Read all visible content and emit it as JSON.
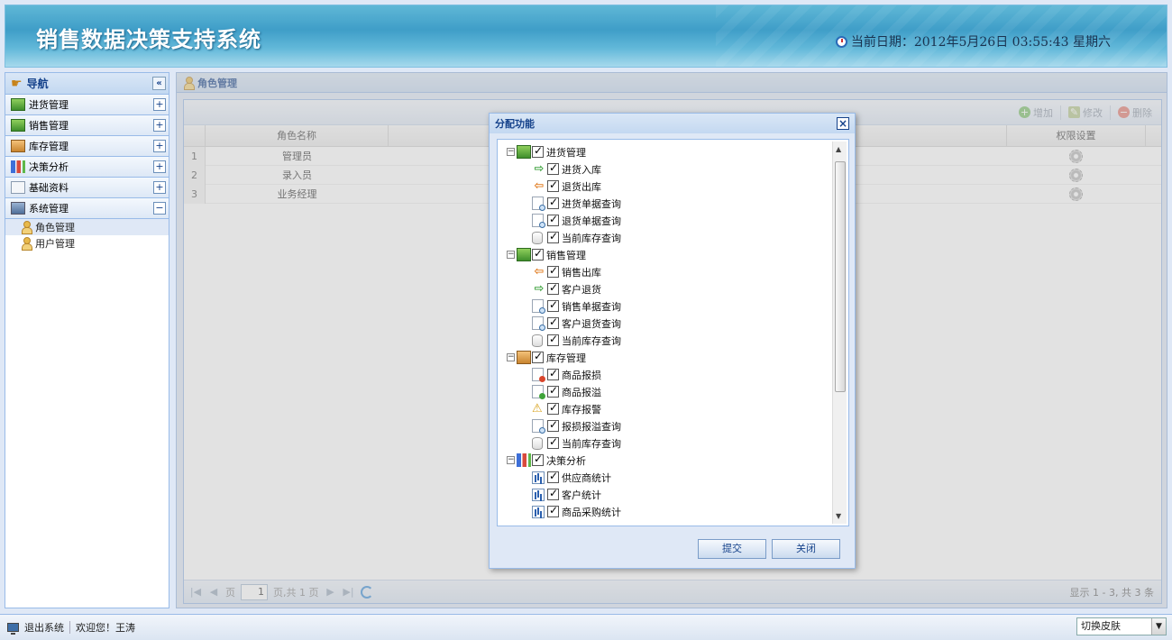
{
  "header": {
    "title": "销售数据决策支持系统",
    "date_label": "当前日期：2012年5月26日  03:55:43 星期六"
  },
  "sidebar": {
    "title": "导航",
    "groups": [
      {
        "label": "进货管理",
        "toggle": "+"
      },
      {
        "label": "销售管理",
        "toggle": "+"
      },
      {
        "label": "库存管理",
        "toggle": "+"
      },
      {
        "label": "决策分析",
        "toggle": "+"
      },
      {
        "label": "基础资料",
        "toggle": "+"
      },
      {
        "label": "系统管理",
        "toggle": "−"
      }
    ],
    "sub_items": [
      {
        "label": "角色管理"
      },
      {
        "label": "用户管理"
      }
    ]
  },
  "main": {
    "title": "角色管理",
    "toolbar": {
      "add": "增加",
      "edit": "修改",
      "delete": "删除"
    },
    "columns": {
      "name": "角色名称",
      "perm": "权限设置"
    },
    "rows": [
      {
        "num": "1",
        "name": "管理员"
      },
      {
        "num": "2",
        "name": "录入员"
      },
      {
        "num": "3",
        "name": "业务经理"
      }
    ],
    "pager": {
      "page_prefix": "页",
      "page_value": "1",
      "page_suffix": "页,共 1 页",
      "info": "显示 1 - 3, 共 3 条"
    }
  },
  "dialog": {
    "title": "分配功能",
    "tree": [
      {
        "label": "进货管理",
        "children": [
          "进货入库",
          "退货出库",
          "进货单据查询",
          "退货单据查询",
          "当前库存查询"
        ]
      },
      {
        "label": "销售管理",
        "children": [
          "销售出库",
          "客户退货",
          "销售单据查询",
          "客户退货查询",
          "当前库存查询"
        ]
      },
      {
        "label": "库存管理",
        "children": [
          "商品报损",
          "商品报溢",
          "库存报警",
          "报损报溢查询",
          "当前库存查询"
        ]
      },
      {
        "label": "决策分析",
        "children": [
          "供应商统计",
          "客户统计",
          "商品采购统计"
        ]
      }
    ],
    "submit": "提交",
    "close": "关闭"
  },
  "footer": {
    "logout": "退出系统",
    "welcome": "欢迎您！王涛",
    "skin": "切换皮肤"
  }
}
